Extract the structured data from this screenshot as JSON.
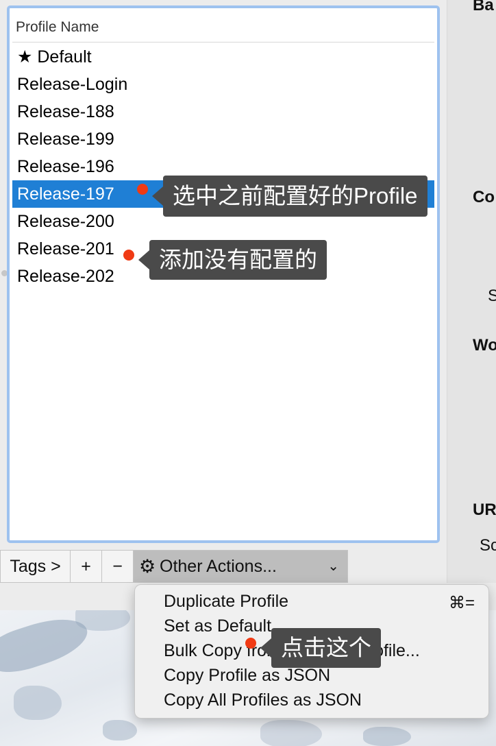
{
  "list": {
    "header": "Profile Name",
    "profiles": [
      {
        "label": "★ Default"
      },
      {
        "label": "Release-Login"
      },
      {
        "label": "Release-188"
      },
      {
        "label": "Release-199"
      },
      {
        "label": "Release-196"
      },
      {
        "label": "Release-197"
      },
      {
        "label": "Release-200"
      },
      {
        "label": "Release-201"
      },
      {
        "label": "Release-202"
      }
    ],
    "selected_index": 5
  },
  "toolbar": {
    "tags_label": "Tags >",
    "add_label": "+",
    "remove_label": "−",
    "other_actions_label": "Other Actions...",
    "gear_icon": "gear-icon",
    "chevron": "⌄"
  },
  "menu": {
    "items": [
      {
        "label": "Duplicate Profile",
        "shortcut": "⌘="
      },
      {
        "label": "Set as Default"
      },
      {
        "label": "Bulk Copy from Selected Profile..."
      },
      {
        "label": "Copy Profile as JSON"
      },
      {
        "label": "Copy All Profiles as JSON"
      }
    ]
  },
  "right_panel": {
    "labels": [
      "Ba",
      "Co",
      "S",
      "Wo",
      "UR",
      "Sc"
    ]
  },
  "annotations": {
    "select_profile": "选中之前配置好的Profile",
    "add_unconfigured": "添加没有配置的",
    "click_this": "点击这个"
  },
  "colors": {
    "selection": "#1f7fd5",
    "list_focus_ring": "#9ec2ef",
    "annotation_bg": "#4a4a4a",
    "annotation_dot": "#f03a14"
  }
}
